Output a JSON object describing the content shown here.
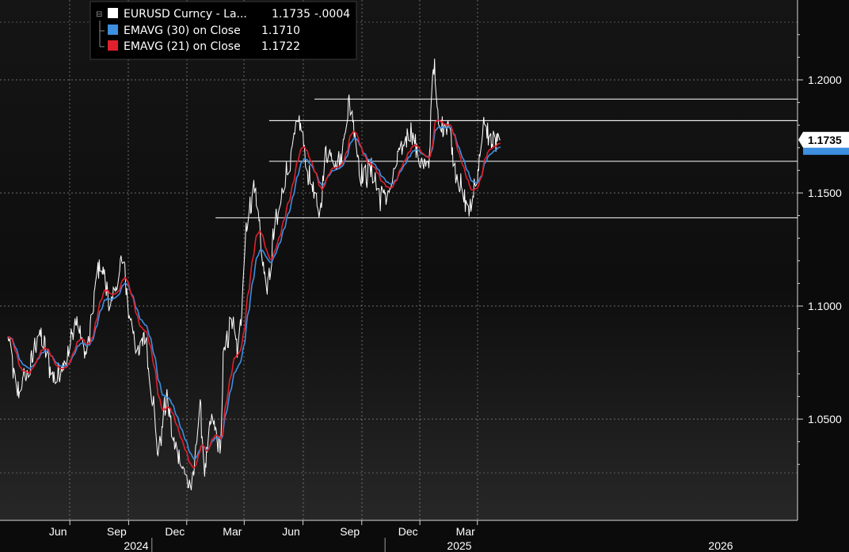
{
  "chart_data": {
    "type": "line",
    "title": "",
    "xlabel": "",
    "ylabel": "",
    "ylim": [
      1.02,
      1.234
    ],
    "grid": true,
    "legend_position": "top-left",
    "colors": {
      "background": "#0b0b0b",
      "price": "#ffffff",
      "ema30": "#3d8fe0",
      "ema21": "#e0202c",
      "grid": "#8a8a8a",
      "price_tag_bg": "#ffffff",
      "ema_tag": "#3d8fe0"
    },
    "legend": [
      {
        "name": "EURUSD Curncy - La...",
        "last": "1.1735",
        "change": "-.0004",
        "color": "#ffffff"
      },
      {
        "name": "EMAVG (30)  on Close",
        "last": "1.1710",
        "color": "#3d8fe0"
      },
      {
        "name": "EMAVG (21)  on Close",
        "last": "1.1722",
        "color": "#e0202c"
      }
    ],
    "y_ticks": [
      "1.2000",
      "1.1500",
      "1.1000",
      "1.0500"
    ],
    "y_tick_values": [
      1.2,
      1.15,
      1.1,
      1.05
    ],
    "x_month_ticks": [
      "Jun",
      "Sep",
      "Dec",
      "Mar",
      "Jun",
      "Sep",
      "Dec",
      "Mar"
    ],
    "x_month_dates": [
      "2024-06-01",
      "2024-09-01",
      "2024-12-01",
      "2025-03-01",
      "2025-06-01",
      "2025-09-01",
      "2025-12-01",
      "2026-03-01"
    ],
    "x_year_labels": [
      "2024",
      "2025",
      "2026"
    ],
    "last_price_label": "1.1735",
    "horizontal_lines": [
      {
        "y": 1.1915,
        "from": "2025-07-25"
      },
      {
        "y": 1.182,
        "from": "2025-05-15"
      },
      {
        "y": 1.164,
        "from": "2025-05-15"
      },
      {
        "y": 1.139,
        "from": "2025-02-20"
      }
    ],
    "price_anchors": [
      [
        "2024-04-01",
        1.085
      ],
      [
        "2024-04-16",
        1.062
      ],
      [
        "2024-05-01",
        1.07
      ],
      [
        "2024-05-20",
        1.087
      ],
      [
        "2024-06-14",
        1.068
      ],
      [
        "2024-07-01",
        1.077
      ],
      [
        "2024-07-17",
        1.093
      ],
      [
        "2024-08-01",
        1.079
      ],
      [
        "2024-08-23",
        1.118
      ],
      [
        "2024-09-11",
        1.101
      ],
      [
        "2024-09-27",
        1.12
      ],
      [
        "2024-10-10",
        1.094
      ],
      [
        "2024-10-23",
        1.078
      ],
      [
        "2024-11-01",
        1.088
      ],
      [
        "2024-11-12",
        1.062
      ],
      [
        "2024-11-22",
        1.036
      ],
      [
        "2024-12-06",
        1.058
      ],
      [
        "2024-12-19",
        1.037
      ],
      [
        "2025-01-13",
        1.02
      ],
      [
        "2025-01-27",
        1.053
      ],
      [
        "2025-02-03",
        1.028
      ],
      [
        "2025-02-14",
        1.049
      ],
      [
        "2025-02-28",
        1.038
      ],
      [
        "2025-03-05",
        1.079
      ],
      [
        "2025-03-18",
        1.093
      ],
      [
        "2025-03-27",
        1.08
      ],
      [
        "2025-04-11",
        1.138
      ],
      [
        "2025-04-21",
        1.152
      ],
      [
        "2025-05-12",
        1.109
      ],
      [
        "2025-05-26",
        1.137
      ],
      [
        "2025-06-12",
        1.16
      ],
      [
        "2025-07-01",
        1.181
      ],
      [
        "2025-07-17",
        1.157
      ],
      [
        "2025-08-01",
        1.141
      ],
      [
        "2025-08-13",
        1.168
      ],
      [
        "2025-09-03",
        1.164
      ],
      [
        "2025-09-17",
        1.189
      ],
      [
        "2025-10-09",
        1.157
      ],
      [
        "2025-10-23",
        1.16
      ],
      [
        "2025-11-05",
        1.148
      ],
      [
        "2025-11-20",
        1.151
      ],
      [
        "2025-12-03",
        1.166
      ],
      [
        "2025-12-22",
        1.178
      ],
      [
        "2026-01-07",
        1.164
      ],
      [
        "2026-01-19",
        1.16
      ],
      [
        "2026-01-27",
        1.207
      ],
      [
        "2026-02-05",
        1.179
      ],
      [
        "2026-02-19",
        1.181
      ],
      [
        "2026-03-04",
        1.159
      ],
      [
        "2026-03-18",
        1.146
      ],
      [
        "2026-03-26",
        1.142
      ],
      [
        "2026-04-02",
        1.154
      ],
      [
        "2026-04-17",
        1.179
      ],
      [
        "2026-04-29",
        1.172
      ],
      [
        "2026-05-12",
        1.1735
      ]
    ]
  }
}
